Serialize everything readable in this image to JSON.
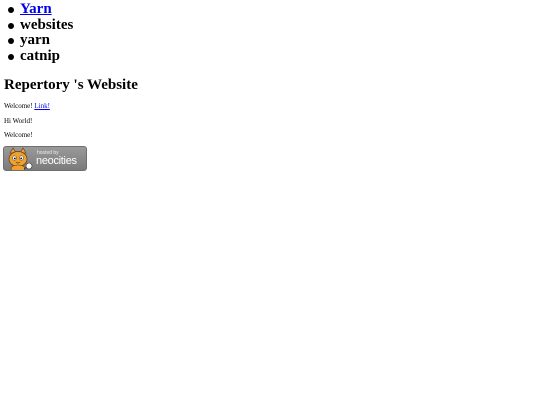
{
  "nav": {
    "items": [
      {
        "label": "Yarn",
        "is_link": true
      },
      {
        "label": "websites",
        "is_link": false
      },
      {
        "label": "yarn",
        "is_link": false
      },
      {
        "label": "catnip",
        "is_link": false
      }
    ]
  },
  "page_title": "Repertory 's Website",
  "paragraphs": [
    {
      "text": "Welcome! ",
      "link_label": "Link!"
    },
    {
      "text": "Hi World!"
    },
    {
      "text": "Welcome!"
    }
  ],
  "badge": {
    "hosted_text": "hosted by",
    "brand_text": "neocities",
    "icon": "neocities-cat-icon"
  },
  "colors": {
    "link": "#0000ee",
    "badge_background": "#8a8a8a",
    "cat_orange": "#f0a030"
  }
}
